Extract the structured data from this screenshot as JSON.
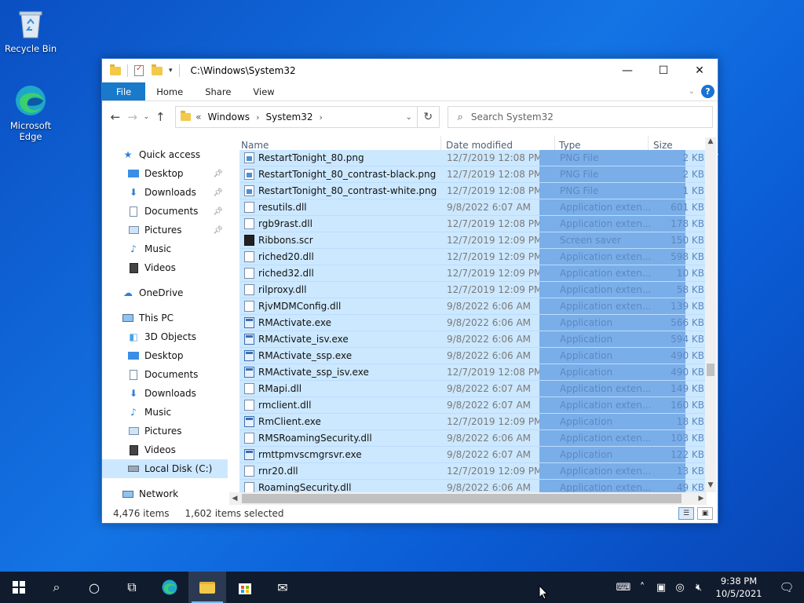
{
  "desktop": {
    "recycle_bin": "Recycle Bin",
    "edge": "Microsoft Edge"
  },
  "window": {
    "title": "C:\\Windows\\System32",
    "minimize": "—",
    "maximize": "☐",
    "close": "✕"
  },
  "ribbon": {
    "tabs": [
      "File",
      "Home",
      "Share",
      "View"
    ]
  },
  "address": {
    "crumbs": [
      "Windows",
      "System32"
    ],
    "prefix": "«",
    "search_placeholder": "Search System32"
  },
  "nav": {
    "quick_access": "Quick access",
    "qa_items": [
      "Desktop",
      "Downloads",
      "Documents",
      "Pictures",
      "Music",
      "Videos"
    ],
    "onedrive": "OneDrive",
    "this_pc": "This PC",
    "pc_items": [
      "3D Objects",
      "Desktop",
      "Documents",
      "Downloads",
      "Music",
      "Pictures",
      "Videos",
      "Local Disk (C:)"
    ],
    "network": "Network"
  },
  "columns": [
    "Name",
    "Date modified",
    "Type",
    "Size"
  ],
  "files": [
    {
      "name": "RestartTonight_80.png",
      "date": "12/7/2019 12:08 PM",
      "type": "PNG File",
      "size": "2 KB",
      "icon": "png"
    },
    {
      "name": "RestartTonight_80_contrast-black.png",
      "date": "12/7/2019 12:08 PM",
      "type": "PNG File",
      "size": "2 KB",
      "icon": "png"
    },
    {
      "name": "RestartTonight_80_contrast-white.png",
      "date": "12/7/2019 12:08 PM",
      "type": "PNG File",
      "size": "1 KB",
      "icon": "png"
    },
    {
      "name": "resutils.dll",
      "date": "9/8/2022 6:07 AM",
      "type": "Application exten...",
      "size": "601 KB",
      "icon": "dll"
    },
    {
      "name": "rgb9rast.dll",
      "date": "12/7/2019 12:08 PM",
      "type": "Application exten...",
      "size": "178 KB",
      "icon": "dll"
    },
    {
      "name": "Ribbons.scr",
      "date": "12/7/2019 12:09 PM",
      "type": "Screen saver",
      "size": "150 KB",
      "icon": "scr"
    },
    {
      "name": "riched20.dll",
      "date": "12/7/2019 12:09 PM",
      "type": "Application exten...",
      "size": "598 KB",
      "icon": "dll"
    },
    {
      "name": "riched32.dll",
      "date": "12/7/2019 12:09 PM",
      "type": "Application exten...",
      "size": "10 KB",
      "icon": "dll"
    },
    {
      "name": "rilproxy.dll",
      "date": "12/7/2019 12:09 PM",
      "type": "Application exten...",
      "size": "58 KB",
      "icon": "dll"
    },
    {
      "name": "RjvMDMConfig.dll",
      "date": "9/8/2022 6:06 AM",
      "type": "Application exten...",
      "size": "139 KB",
      "icon": "dll"
    },
    {
      "name": "RMActivate.exe",
      "date": "9/8/2022 6:06 AM",
      "type": "Application",
      "size": "566 KB",
      "icon": "exe"
    },
    {
      "name": "RMActivate_isv.exe",
      "date": "9/8/2022 6:06 AM",
      "type": "Application",
      "size": "594 KB",
      "icon": "exe"
    },
    {
      "name": "RMActivate_ssp.exe",
      "date": "9/8/2022 6:06 AM",
      "type": "Application",
      "size": "490 KB",
      "icon": "exe"
    },
    {
      "name": "RMActivate_ssp_isv.exe",
      "date": "12/7/2019 12:08 PM",
      "type": "Application",
      "size": "490 KB",
      "icon": "exe"
    },
    {
      "name": "RMapi.dll",
      "date": "9/8/2022 6:07 AM",
      "type": "Application exten...",
      "size": "149 KB",
      "icon": "dll"
    },
    {
      "name": "rmclient.dll",
      "date": "9/8/2022 6:07 AM",
      "type": "Application exten...",
      "size": "160 KB",
      "icon": "dll"
    },
    {
      "name": "RmClient.exe",
      "date": "12/7/2019 12:09 PM",
      "type": "Application",
      "size": "18 KB",
      "icon": "exe"
    },
    {
      "name": "RMSRoamingSecurity.dll",
      "date": "9/8/2022 6:06 AM",
      "type": "Application exten...",
      "size": "103 KB",
      "icon": "dll"
    },
    {
      "name": "rmttpmvscmgrsvr.exe",
      "date": "9/8/2022 6:07 AM",
      "type": "Application",
      "size": "122 KB",
      "icon": "exe"
    },
    {
      "name": "rnr20.dll",
      "date": "12/7/2019 12:09 PM",
      "type": "Application exten...",
      "size": "13 KB",
      "icon": "dll"
    },
    {
      "name": "RoamingSecurity.dll",
      "date": "9/8/2022 6:06 AM",
      "type": "Application exten...",
      "size": "49 KB",
      "icon": "dll"
    }
  ],
  "status": {
    "items": "4,476 items",
    "selected": "1,602 items selected"
  },
  "taskbar": {
    "time": "9:38 PM",
    "date": "10/5/2021"
  }
}
